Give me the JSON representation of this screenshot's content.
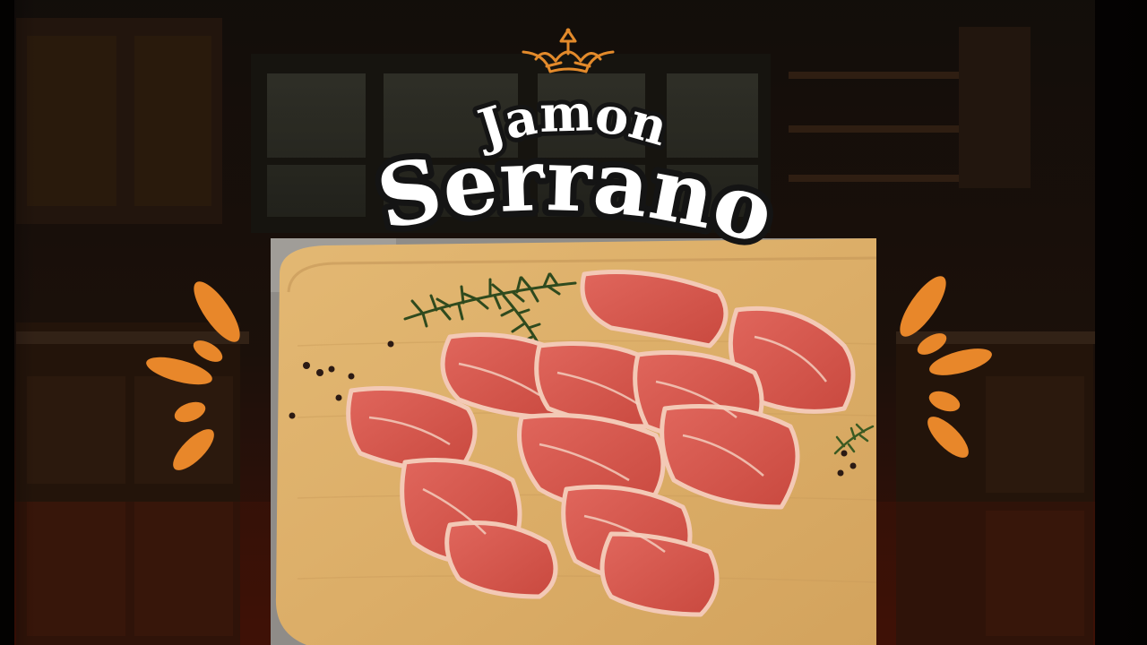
{
  "title": {
    "line1": "Jamon",
    "line2": "Serrano"
  },
  "colors": {
    "accent_orange": "#e8872a",
    "crown_orange": "#e38a2b",
    "board_wood": "#ddb06a",
    "ham_red": "#d8584f",
    "ham_fat": "#f3c9b6",
    "rosemary": "#2f4a1e",
    "background_dark": "#1e120c",
    "background_red_tint": "#5a1608"
  },
  "icons": {
    "crown": "crown-icon",
    "burst_left": "burst-lines-icon",
    "burst_right": "burst-lines-icon"
  }
}
